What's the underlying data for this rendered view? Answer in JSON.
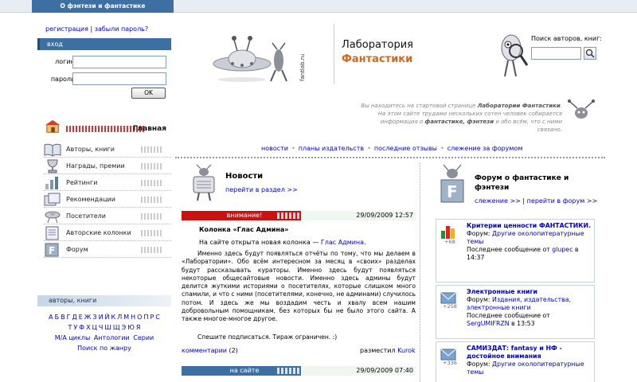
{
  "topbar": {
    "tab_label": "О фэнтези и фантастике"
  },
  "auth": {
    "register": "регистрация",
    "separator": "|",
    "forgot": "забыли пароль?",
    "box_title": "вход",
    "login_label": "логин :",
    "password_label": "пароль :",
    "ok_label": "OK"
  },
  "nav": {
    "home": "Главная",
    "items": [
      {
        "label": "Авторы, книги",
        "icon": "book-icon"
      },
      {
        "label": "Награды, премии",
        "icon": "trophy-icon"
      },
      {
        "label": "Рейтинги",
        "icon": "chart-icon"
      },
      {
        "label": "Рекомендации",
        "icon": "recommend-icon"
      },
      {
        "label": "Посетители",
        "icon": "visitors-icon"
      },
      {
        "label": "Авторские колонки",
        "icon": "columns-icon"
      },
      {
        "label": "Форум",
        "icon": "forum-icon"
      }
    ]
  },
  "authors": {
    "head": "авторы, книги",
    "row1": [
      "А",
      "Б",
      "В",
      "Г",
      "Д",
      "Е",
      "Ж",
      "З",
      "И",
      "Й",
      "К",
      "Л",
      "М",
      "Н",
      "О",
      "П",
      "Р",
      "С"
    ],
    "row2": [
      "Т",
      "У",
      "Ф",
      "Х",
      "Ц",
      "Ч",
      "Ш",
      "Щ",
      "Э",
      "Ю",
      "Я"
    ],
    "row3": [
      "М/А циклы",
      "Антологии",
      "Серии"
    ],
    "row4": "Поиск по жанру"
  },
  "header": {
    "logo_text": "fantlab.ru",
    "title_1": "Лаборатория",
    "title_2": "Фантастики",
    "search_label": "Поиск авторов, книг:",
    "search_value": ""
  },
  "welcome": {
    "p1": "Вы находитесь на стартовой странице ",
    "b1": "Лаборатории Фантастики",
    "p2": ". На этом сайте трудами нескольких сотен человек собирается информация о ",
    "b2": "фантастике, фэнтези",
    "p3": " и обо всём, что с ними связано."
  },
  "menu": [
    "новости",
    "планы издательств",
    "последние отзывы",
    "слежение за форумом"
  ],
  "news": {
    "title": "Новости",
    "more": "перейти в раздел >>",
    "post1": {
      "badge": "внимание!",
      "date": "29/09/2009 12:57",
      "title": "Колонка «Глас Админа»",
      "lead_text": "На сайте открыта новая колонка — ",
      "lead_link": "Глас Админа",
      "lead_end": ".",
      "body": "Именно здесь будут появляться отчёты по тому, что мы делаем в «Лаборатории». Обо всём интересном за месяц в «своих» разделах будут рассказывать кураторы. Именно здесь будут появляться некоторые общесайтовые новости. Именно здесь админы будут делится жуткими историями о посетителях, которые слишком много спамили, и что с ними (посетителями, конечно, не админами) случилось потом. И здесь же мы воздадим честь и хвалу всем нашим добровольным помощникам, без которых бы не было этого сайта. А также многое-многое другое.",
      "tail": "Спешите подписаться. Тираж ограничен. :)",
      "comments_label": "комментарии",
      "comments_count": "(2)",
      "author_label": "разместил",
      "author": "Kurok"
    },
    "post2": {
      "badge": "на сайте",
      "date": "29/09/2009 07:40"
    }
  },
  "forum": {
    "title": "Форум о фантастике и фэнтези",
    "tracking": "слежение >>",
    "sep": "|",
    "goto": "перейти в форум >>",
    "items": [
      {
        "title": "Критерии ценности ФАНТАСТИКИ.",
        "forum_label": "Форум: ",
        "forum": "Другие околопитературные темы",
        "last_label": "Последнее сообщение от ",
        "last_user": "glupec",
        "last_time": " в 14:37",
        "count": "+68"
      },
      {
        "title": "Электронные книги",
        "forum_label": "Форум: ",
        "forum": "Издания, издательства, электронные книги",
        "last_label": "Последнее сообщение от ",
        "last_user": "SergUMIFRZN",
        "last_time": " в 13:53",
        "count": "+258"
      },
      {
        "title": "САМИЗДАТ: fantasy и НФ - достойное внимания",
        "forum_label": "Форум: ",
        "forum": "Другие околопитературные темы",
        "last_label": "",
        "last_user": "",
        "last_time": "",
        "count": "+336"
      }
    ]
  },
  "colors": {
    "accent": "#3d6fa3",
    "alert": "#cc1111",
    "link": "#0000cc",
    "title_orange": "#d2691e"
  }
}
